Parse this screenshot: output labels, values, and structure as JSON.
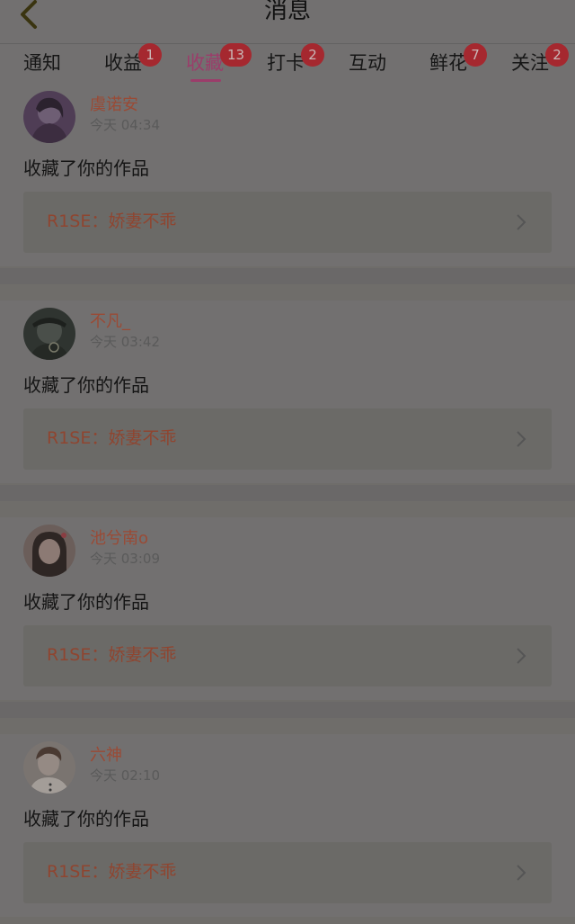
{
  "header": {
    "title": "消息"
  },
  "tabs": [
    {
      "label": "通知",
      "badge": ""
    },
    {
      "label": "收益",
      "badge": "1"
    },
    {
      "label": "收藏",
      "badge": "13",
      "active": true
    },
    {
      "label": "打卡",
      "badge": "2"
    },
    {
      "label": "互动",
      "badge": ""
    },
    {
      "label": "鲜花",
      "badge": "7"
    },
    {
      "label": "关注",
      "badge": "2"
    }
  ],
  "items": [
    {
      "user": "虞诺安",
      "time": "今天 04:34",
      "action": "收藏了你的作品",
      "work": "R1SE：娇妻不乖"
    },
    {
      "user": "不凡_",
      "time": "今天 03:42",
      "action": "收藏了你的作品",
      "work": "R1SE：娇妻不乖"
    },
    {
      "user": "池兮南o",
      "time": "今天 03:09",
      "action": "收藏了你的作品",
      "work": "R1SE：娇妻不乖"
    },
    {
      "user": "六神",
      "time": "今天 02:10",
      "action": "收藏了你的作品",
      "work": "R1SE：娇妻不乖"
    }
  ],
  "colors": {
    "accent": "#9b3d6a",
    "badge": "#a5282f",
    "username": "#9a4a35"
  }
}
